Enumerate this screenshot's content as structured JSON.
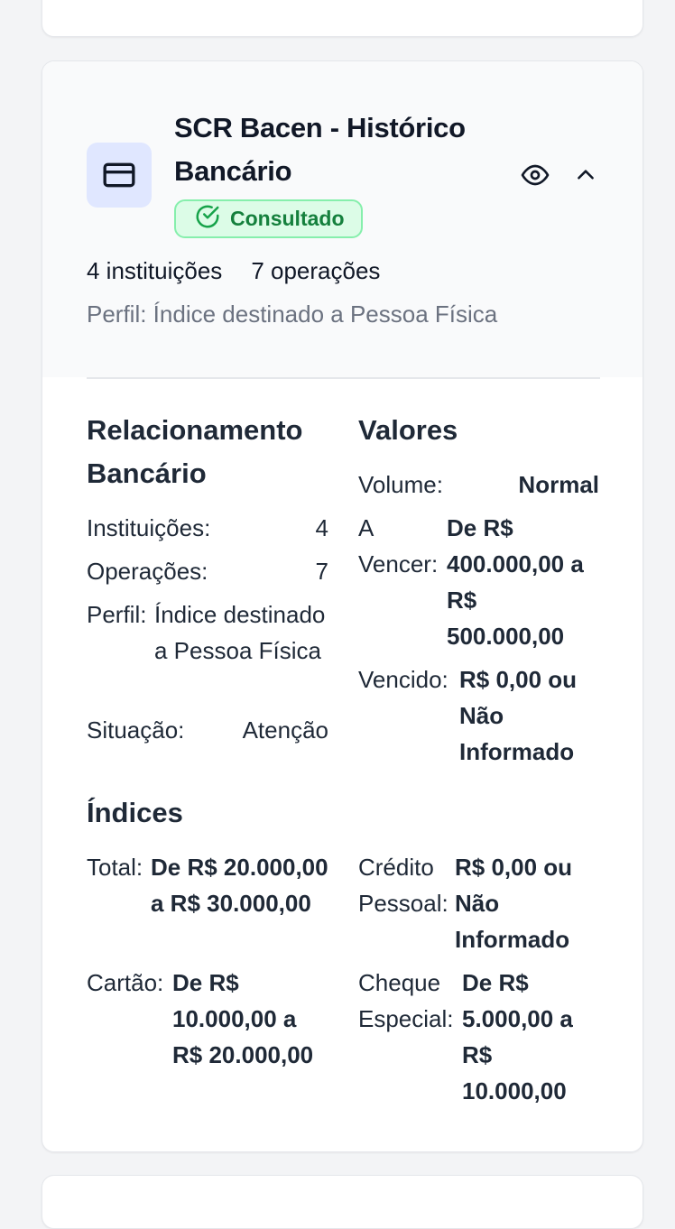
{
  "card": {
    "title": "SCR Bacen - Histórico Bancário",
    "status": "Consultado",
    "summary": {
      "institutions": "4 instituições",
      "operations": "7 operações"
    },
    "profile_line": "Perfil: Índice destinado a Pessoa Física",
    "icons": {
      "main": "credit-card-icon",
      "status": "check-circle-icon",
      "view": "eye-icon",
      "toggle": "chevron-up-icon"
    }
  },
  "relacionamento": {
    "title": "Relacionamento Bancário",
    "instituicoes": {
      "label": "Instituições:",
      "value": "4"
    },
    "operacoes": {
      "label": "Operações:",
      "value": "7"
    },
    "perfil": {
      "label": "Perfil:",
      "value": "Índice destinado a Pessoa Física"
    },
    "situacao": {
      "label": "Situação:",
      "value": "Atenção"
    }
  },
  "valores": {
    "title": "Valores",
    "volume": {
      "label": "Volume:",
      "value": "Normal"
    },
    "a_vencer": {
      "label": "A Vencer:",
      "value": "De R$ 400.000,00 a R$ 500.000,00"
    },
    "vencido": {
      "label": "Vencido:",
      "value": "R$ 0,00 ou Não Informado"
    }
  },
  "indices": {
    "title": "Índices",
    "total": {
      "label": "Total:",
      "value": "De R$ 20.000,00 a R$ 30.000,00"
    },
    "credito_pessoal": {
      "label": "Crédito Pessoal:",
      "value": "R$ 0,00 ou Não Informado"
    },
    "cartao": {
      "label": "Cartão:",
      "value": "De R$ 10.000,00 a R$ 20.000,00"
    },
    "cheque_especial": {
      "label": "Cheque Especial:",
      "value": "De R$ 5.000,00 a R$ 10.000,00"
    }
  },
  "colors": {
    "accent_bg": "#e0e7ff",
    "success_bg": "#dcfce7",
    "success_border": "#86efac",
    "success_text": "#15803d"
  }
}
